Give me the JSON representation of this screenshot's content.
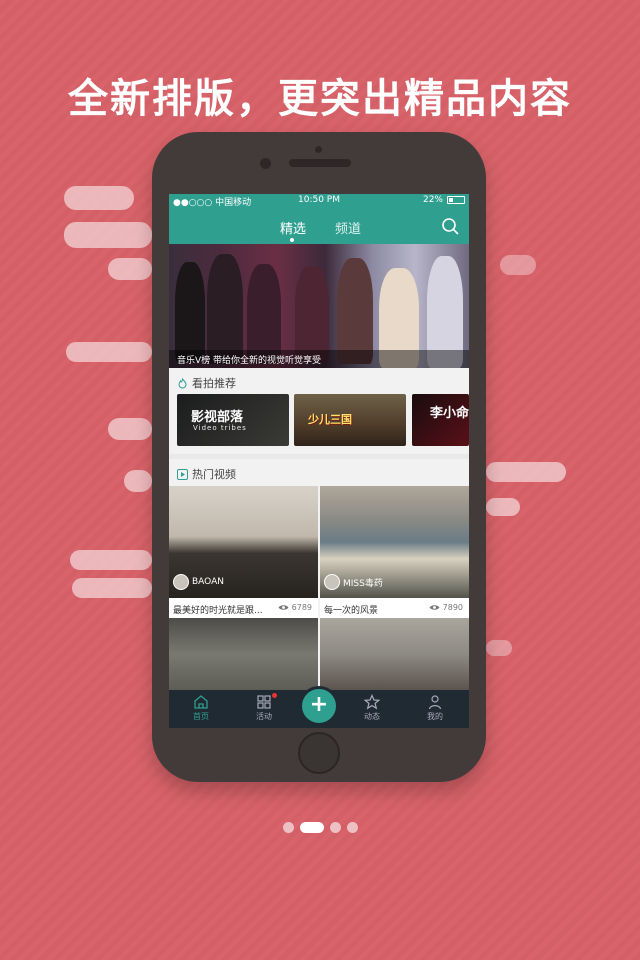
{
  "headline": "全新排版，更突出精品内容",
  "status_bar": {
    "carrier": "●●○○○ 中国移动",
    "time": "10:50 PM",
    "battery": "22%"
  },
  "nav": {
    "tabs": [
      {
        "label": "精选",
        "active": true
      },
      {
        "label": "频道",
        "active": false
      }
    ]
  },
  "banner": {
    "caption": "音乐V榜  带给你全新的视觉听觉享受"
  },
  "recommend": {
    "title": "看拍推荐",
    "cards": [
      {
        "title": "影视部落",
        "subtitle": "Video tribes"
      },
      {
        "title": "少儿三国"
      },
      {
        "title": "李小命"
      }
    ]
  },
  "hot": {
    "title": "热门视频",
    "videos": [
      {
        "author": "BAOAN",
        "title": "最美好的时光就是跟...",
        "views": "6789"
      },
      {
        "author": "MISS毒药",
        "title": "每一次的风景",
        "views": "7890"
      }
    ]
  },
  "tabbar": {
    "items": [
      {
        "label": "首页",
        "icon": "home-icon",
        "active": true
      },
      {
        "label": "活动",
        "icon": "grid-icon",
        "active": false
      },
      {
        "label": "动态",
        "icon": "star-icon",
        "active": false
      },
      {
        "label": "我的",
        "icon": "person-icon",
        "active": false
      }
    ],
    "fab_label": "+"
  },
  "pager": {
    "count": 4,
    "active_index": 1
  },
  "colors": {
    "accent": "#2f9f90",
    "background": "#d8636a",
    "tabbar": "#1f2a33"
  }
}
